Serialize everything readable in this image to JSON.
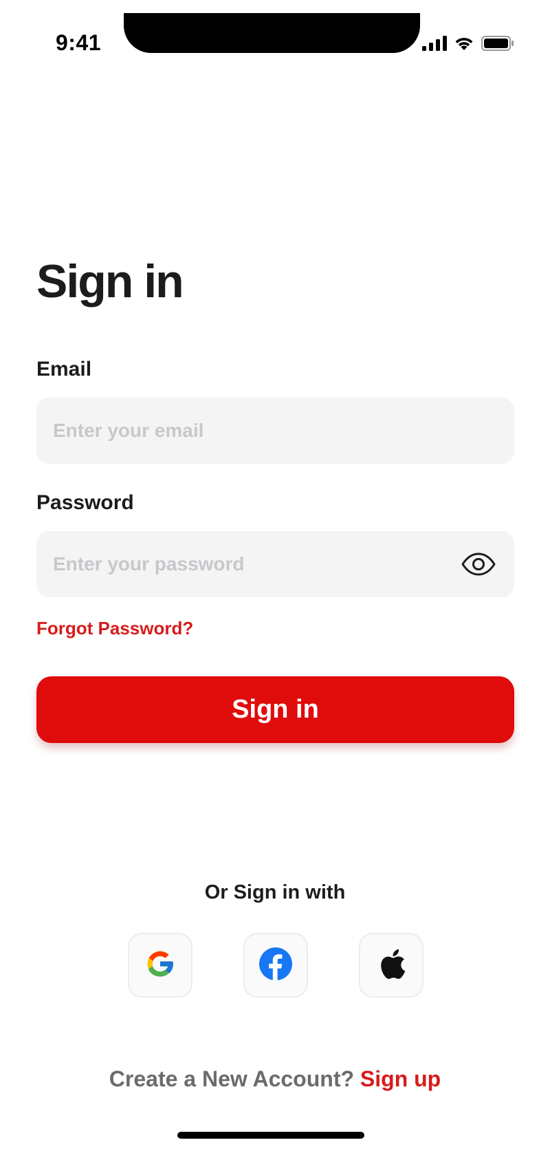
{
  "status_bar": {
    "time": "9:41"
  },
  "page": {
    "title": "Sign in"
  },
  "form": {
    "email_label": "Email",
    "email_placeholder": "Enter your email",
    "email_value": "",
    "password_label": "Password",
    "password_placeholder": "Enter your password",
    "password_value": "",
    "forgot_label": "Forgot Password?",
    "submit_label": "Sign in"
  },
  "social": {
    "divider_label": "Or Sign in with",
    "providers": [
      {
        "icon": "google-icon"
      },
      {
        "icon": "facebook-icon"
      },
      {
        "icon": "apple-icon"
      }
    ]
  },
  "footer": {
    "prompt": "Create a New Account?",
    "link_label": "Sign up"
  },
  "colors": {
    "accent": "#e00b0b",
    "link": "#d81b1b",
    "input_bg": "#f4f4f5",
    "placeholder": "#c8c8cc",
    "text": "#1c1c1e",
    "muted": "#6b6b6f"
  }
}
